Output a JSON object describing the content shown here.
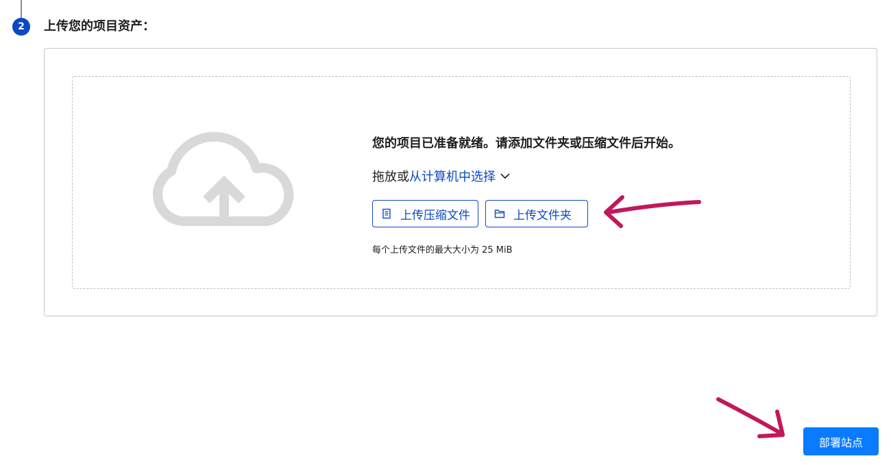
{
  "step": {
    "number": "2",
    "title": "上传您的项目资产："
  },
  "dropzone": {
    "ready_text": "您的项目已准备就绪。请添加文件夹或压缩文件后开始。",
    "drag_text": "拖放或",
    "select_link": "从计算机中选择",
    "upload_zip_label": "上传压缩文件",
    "upload_folder_label": "上传文件夹",
    "size_note": "每个上传文件的最大大小为 25 MiB"
  },
  "footer": {
    "deploy_label": "部署站点"
  },
  "colors": {
    "accent": "#0a49c2",
    "primary_button": "#0a7bff",
    "annotation_arrow": "#c2185b",
    "cloud": "#d9d9d9"
  },
  "icons": {
    "cloud": "cloud-upload-icon",
    "chevron": "chevron-down-icon",
    "zip": "file-icon",
    "folder": "folder-icon",
    "arrow": "annotation-arrow"
  }
}
